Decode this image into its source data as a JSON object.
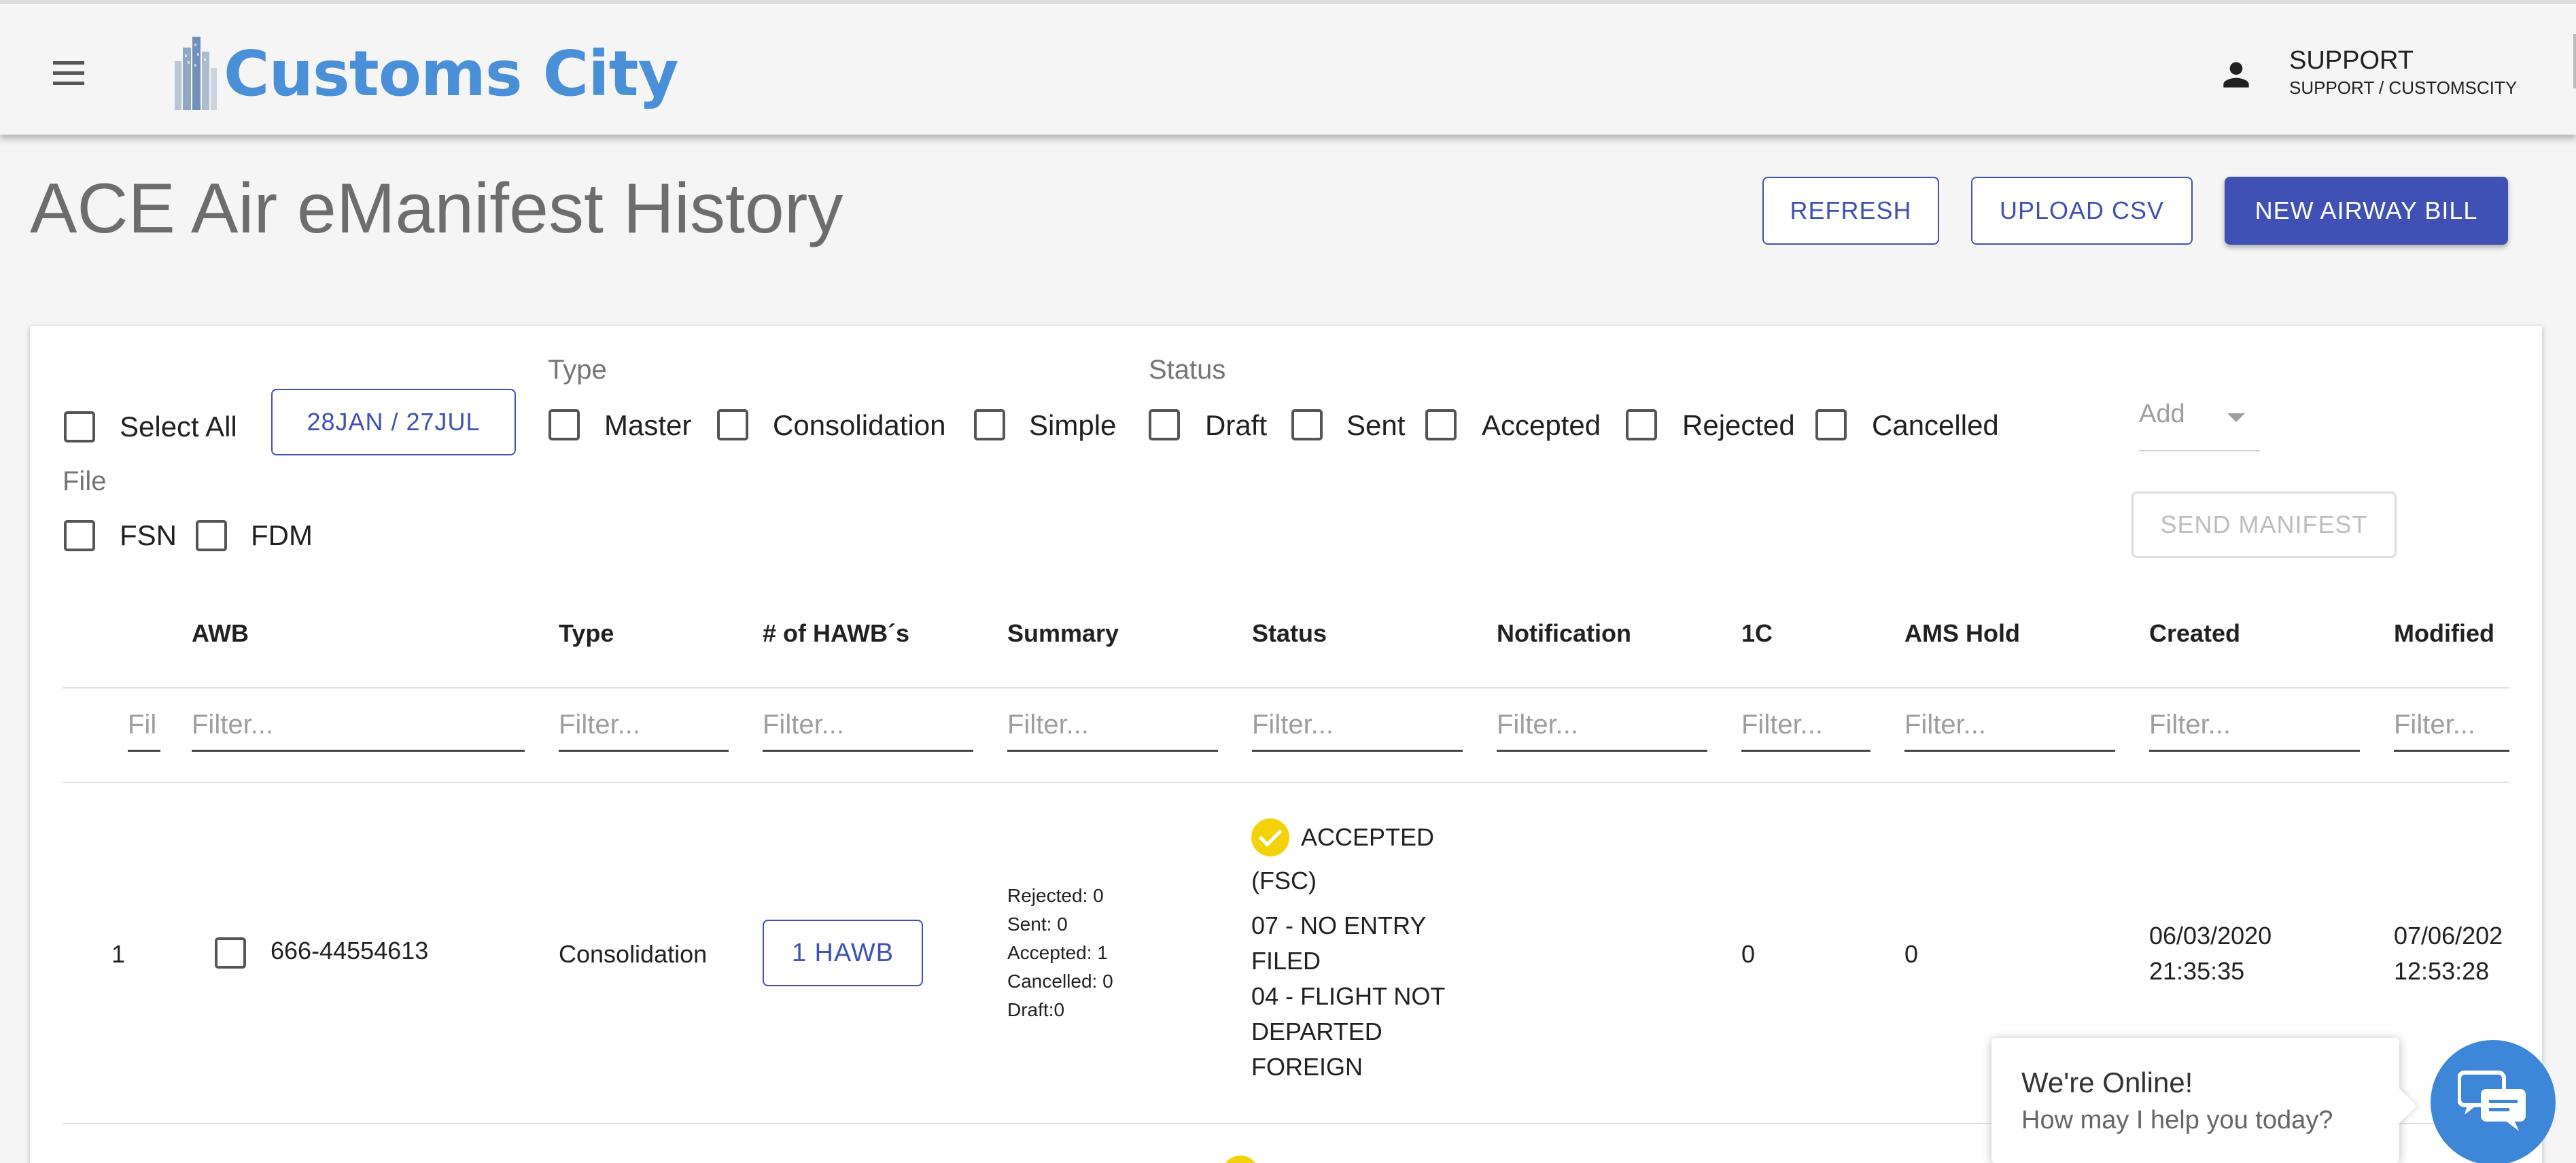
{
  "header": {
    "logo_text": "Customs City",
    "user_name": "SUPPORT",
    "user_org": "SUPPORT / CUSTOMSCITY",
    "icons": {
      "menu": "hamburger-menu-icon",
      "user": "person-icon"
    }
  },
  "page": {
    "title": "ACE Air eManifest History",
    "refresh_label": "REFRESH",
    "upload_label": "UPLOAD CSV",
    "new_label": "NEW AIRWAY BILL"
  },
  "filters": {
    "select_all_label": "Select All",
    "date_range_label": "28JAN / 27JUL",
    "type_group": "Type",
    "type_options": [
      "Master",
      "Consolidation",
      "Simple"
    ],
    "status_group": "Status",
    "status_options": [
      "Draft",
      "Sent",
      "Accepted",
      "Rejected",
      "Cancelled"
    ],
    "add_placeholder": "Add",
    "file_group": "File",
    "file_options": [
      "FSN",
      "FDM"
    ],
    "send_manifest_label": "SEND MANIFEST"
  },
  "table": {
    "columns": [
      "AWB",
      "Type",
      "# of HAWB´s",
      "Summary",
      "Status",
      "Notification",
      "1C",
      "AMS Hold",
      "Created",
      "Modified"
    ],
    "filter_placeholder": "Filter...",
    "row_index_placeholder": "Fil",
    "rows": [
      {
        "index": "1",
        "awb": "666-44554613",
        "type": "Consolidation",
        "hawb_label": "1 HAWB",
        "summary": [
          "Rejected: 0",
          "Sent: 0",
          "Accepted: 1",
          "Cancelled: 0",
          "Draft:0"
        ],
        "status_label": "ACCEPTED",
        "status_detail": "(FSC)",
        "status_codes": [
          "07 - NO ENTRY FILED",
          "04 - FLIGHT NOT DEPARTED FOREIGN"
        ],
        "status_icon": "check-circle-icon",
        "notification": "",
        "one_c": "0",
        "ams_hold": "0",
        "created_date": "06/03/2020",
        "created_time": "21:35:35",
        "modified_date": "07/06/202",
        "modified_time": "12:53:28"
      }
    ]
  },
  "chat": {
    "title": "We're Online!",
    "subtitle": "How may I help you today?",
    "icon": "chat-bubbles-icon"
  },
  "colors": {
    "primary": "#3f51b5",
    "logo": "#4a90d9",
    "accepted": "#f4d20a",
    "chat": "#3d86d8",
    "title": "#6d6d6d"
  }
}
